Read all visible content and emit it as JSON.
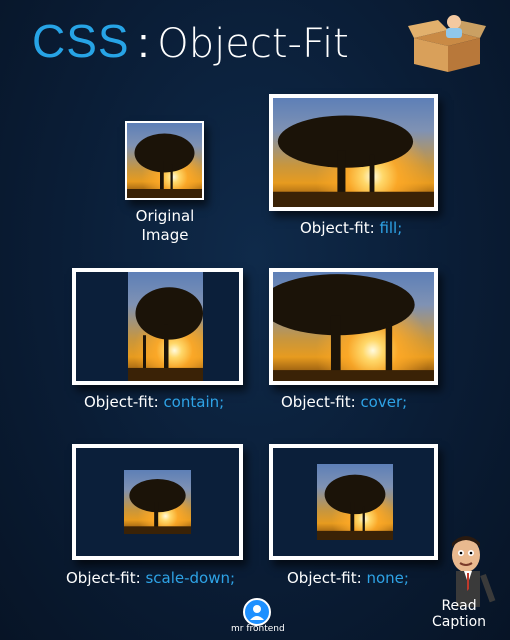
{
  "title": {
    "css": "CSS",
    "colon": ":",
    "main": "Object-Fit"
  },
  "captions": {
    "original_line1": "Original",
    "original_line2": "Image",
    "prefix": "Object-fit:",
    "fill": "fill;",
    "contain": "contain;",
    "cover": "cover;",
    "scale_down": "scale-down;",
    "none": "none;"
  },
  "footer": {
    "brand": "mr frontend",
    "read_line1": "Read",
    "read_line2": "Caption"
  },
  "colors": {
    "accent": "#27a4e6",
    "background": "#0a1d36",
    "frame": "#ffffff"
  },
  "icons": [
    "cardboard-box-icon",
    "brand-logo-icon",
    "cartoon-character-icon"
  ]
}
